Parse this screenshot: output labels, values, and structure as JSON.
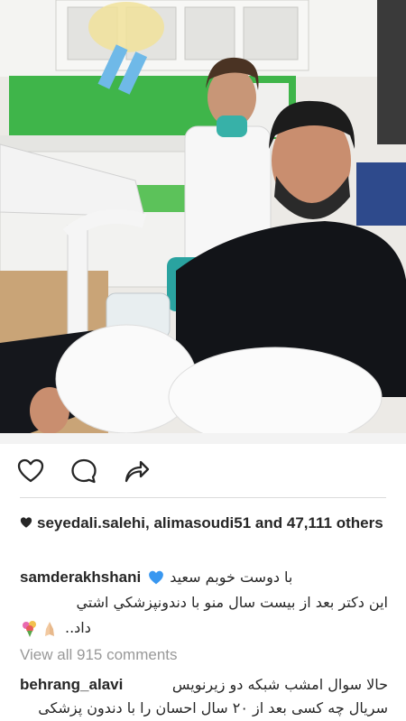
{
  "post": {
    "image_alt": "photo"
  },
  "actions": {
    "like_icon": "heart-outline-icon",
    "comment_icon": "comment-bubble-icon",
    "share_icon": "share-arrow-icon"
  },
  "likes": {
    "users": "seyedali.salehi, alimasoudi51",
    "connector": " and ",
    "count": "47,111",
    "suffix": " others"
  },
  "caption": {
    "username": "samderakhshani",
    "line1": "با دوست خوبم سعید",
    "line2": "این دکتر بعد از بیست سال منو با دندونپزشکي اشتي",
    "line3": "داد..",
    "emojis": [
      "bouquet-emoji",
      "folded-hands-emoji"
    ]
  },
  "comments": {
    "view_all": "View all 915 comments",
    "items": [
      {
        "username": "behrang_alavi",
        "line1": "حالا سوال امشب شبکه دو زیرنویس",
        "line2": "سریال چه کسی بعد از ۲۰ سال احسان را با دندون پزشکی"
      }
    ]
  },
  "colors": {
    "text": "#262626",
    "muted": "#999999",
    "divider": "#dbdbdb",
    "blue_heart": "#3897f0"
  }
}
